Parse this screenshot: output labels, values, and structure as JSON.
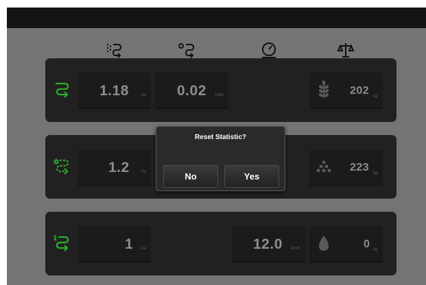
{
  "colors": {
    "background": "#747474",
    "top_bar": "#141414",
    "panel": "#212121",
    "cell": "#1b1b1b",
    "accent_green": "#2bb02b",
    "value_text": "#8e8e8e",
    "dialog_text": "#ffffff"
  },
  "header_icons": [
    "worked-area-icon",
    "distance-icon",
    "speed-gauge-icon",
    "scale-weight-icon"
  ],
  "rows": [
    {
      "icon": "green-arrows-icon",
      "area": {
        "value": "1.18",
        "unit": "ha"
      },
      "rate": {
        "value": "0.02",
        "unit": "ha/h"
      },
      "speed": {
        "value": "",
        "unit": ""
      },
      "weight": {
        "icon": "grain-icon",
        "value": "202",
        "unit": "kg"
      }
    },
    {
      "icon": "green-arrows-dashed-icon",
      "area": {
        "value": "1.2",
        "unit": "ha"
      },
      "weight": {
        "icon": "seeds-icon",
        "value": "223",
        "unit": "kg"
      }
    },
    {
      "icon": "green-arrows-3-icon",
      "area": {
        "value": "1",
        "unit": "ha"
      },
      "speed": {
        "value": "12.0",
        "unit": "km/h"
      },
      "weight": {
        "icon": "fertilizer-drop-icon",
        "value": "0",
        "unit": "kg"
      }
    }
  ],
  "dialog": {
    "title": "Reset Statistic?",
    "no_label": "No",
    "yes_label": "Yes"
  }
}
